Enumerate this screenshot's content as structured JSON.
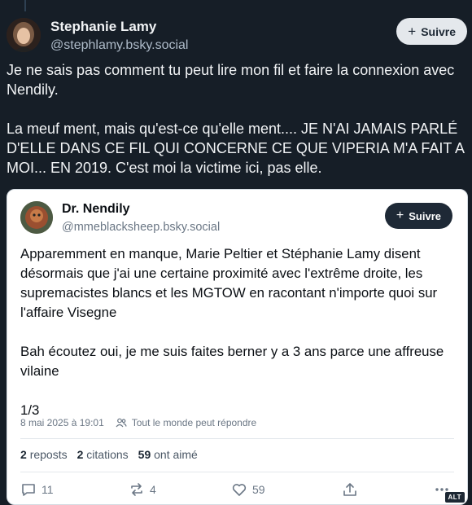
{
  "post": {
    "author": {
      "display_name": "Stephanie Lamy",
      "handle": "@stephlamy.bsky.social"
    },
    "follow_label": "Suivre",
    "text": "Je ne sais pas comment tu peut lire mon fil et faire la connexion avec Nendily.\n\nLa meuf ment, mais qu'est-ce qu'elle ment.... JE N'AI JAMAIS PARLÉ D'ELLE DANS CE FIL QUI CONCERNE CE QUE VIPERIA M'A FAIT A MOI... EN 2019. C'est moi la victime ici, pas elle."
  },
  "quoted_post": {
    "author": {
      "display_name": "Dr. Nendily",
      "handle": "@mmeblacksheep.bsky.social"
    },
    "follow_label": "Suivre",
    "text": "Apparemment en manque, Marie Peltier et Stéphanie Lamy disent désormais que j'ai une certaine proximité avec l'extrême droite, les supremacistes blancs et les MGTOW en racontant n'importe quoi sur l'affaire Visegne\n\nBah écoutez oui, je me suis faites berner y a 3 ans parce une affreuse vilaine\n\n1/3",
    "timestamp": "8 mai 2025 à 19:01",
    "reply_setting": "Tout le monde peut répondre",
    "stats": {
      "reposts_count": "2",
      "reposts_label": "reposts",
      "quotes_count": "2",
      "quotes_label": "citations",
      "likes_count": "59",
      "likes_label": "ont aimé"
    },
    "actions": {
      "replies": "11",
      "reposts": "4",
      "likes": "59"
    }
  },
  "alt_badge": "ALT",
  "icons": [
    "person-avatar",
    "reply-icon",
    "repost-icon",
    "heart-icon",
    "share-icon",
    "more-icon",
    "people-icon",
    "plus-icon"
  ]
}
